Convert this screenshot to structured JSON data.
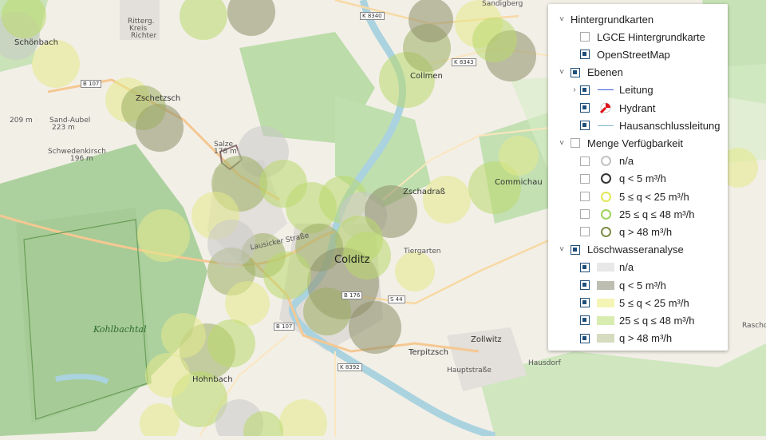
{
  "map": {
    "labels": {
      "colditz": "Colditz",
      "schoenbach": "Schönbach",
      "zschetzsch": "Zschetzsch",
      "collmen": "Collmen",
      "commichau": "Commichau",
      "zschadrass": "Zschadraß",
      "tiergarten": "Tiergarten",
      "terpitzsch": "Terpitzsch",
      "zollwitz": "Zollwitz",
      "hausdorf": "Hausdorf",
      "hohnbach": "Hohnbach",
      "kohlbachtal": "Kohlbachtal",
      "sandigberg": "Sandigberg",
      "salze": "Salze",
      "salze_ele": "178 m",
      "sand_aubel": "Sand-Aubel",
      "sand_aubel_ele": "223 m",
      "schwedenkirsch": "Schwedenkirsch",
      "schwedenkirsch_ele": "196 m",
      "hill_209": "209 m",
      "rittergut": "Ritterg.",
      "kreis": "Kreis",
      "richter": "Richter",
      "rascho": "Rascho",
      "lausicker_strasse": "Lausicker Straße",
      "hauptstrasse": "Hauptstraße",
      "roads": {
        "b107a": "B 107",
        "b107b": "B 107",
        "b176": "B 176",
        "k8340": "K 8340",
        "k8343": "K 8343",
        "k8392": "K 8392",
        "s44": "S 44"
      }
    },
    "circle_colors": {
      "none": "#c9c9c9",
      "lt5": "#8e8f6a",
      "5to25": "#e4ea8a",
      "25to48": "#b9d86c",
      "gt48": "#9cae62"
    }
  },
  "panel": {
    "groups": [
      {
        "label": "Hintergrundkarten",
        "items": [
          {
            "label": "LGCE Hintergrundkarte",
            "checked": false
          },
          {
            "label": "OpenStreetMap",
            "checked": true
          }
        ]
      },
      {
        "label": "Ebenen",
        "checked": true,
        "items": [
          {
            "label": "Leitung",
            "checked": true,
            "symbol": "line-blue"
          },
          {
            "label": "Hydrant",
            "checked": true,
            "symbol": "hydrant"
          },
          {
            "label": "Hausanschlussleitung",
            "checked": true,
            "symbol": "line-grey"
          }
        ]
      },
      {
        "label": "Menge Verfügbarkeit",
        "checked": false,
        "items": [
          {
            "label": "n/a",
            "checked": false,
            "color": "#c2c2c2"
          },
          {
            "label": "q < 5 m³/h",
            "checked": false,
            "color": "#333333"
          },
          {
            "label": "5 ≤ q < 25 m³/h",
            "checked": false,
            "color": "#e2e655"
          },
          {
            "label": "25 ≤ q ≤ 48 m³/h",
            "checked": false,
            "color": "#9fd35c"
          },
          {
            "label": "q > 48 m³/h",
            "checked": false,
            "color": "#7c8c45"
          }
        ]
      },
      {
        "label": "Löschwasseranalyse",
        "checked": true,
        "items": [
          {
            "label": "n/a",
            "checked": true,
            "color": "#e8e8e8"
          },
          {
            "label": "q < 5 m³/h",
            "checked": true,
            "color": "#bdbdb2"
          },
          {
            "label": "5 ≤ q < 25 m³/h",
            "checked": true,
            "color": "#f4f5b5"
          },
          {
            "label": "25 ≤ q ≤ 48 m³/h",
            "checked": true,
            "color": "#d8ecb0"
          },
          {
            "label": "q > 48 m³/h",
            "checked": true,
            "color": "#d5dcc0"
          }
        ]
      }
    ]
  }
}
